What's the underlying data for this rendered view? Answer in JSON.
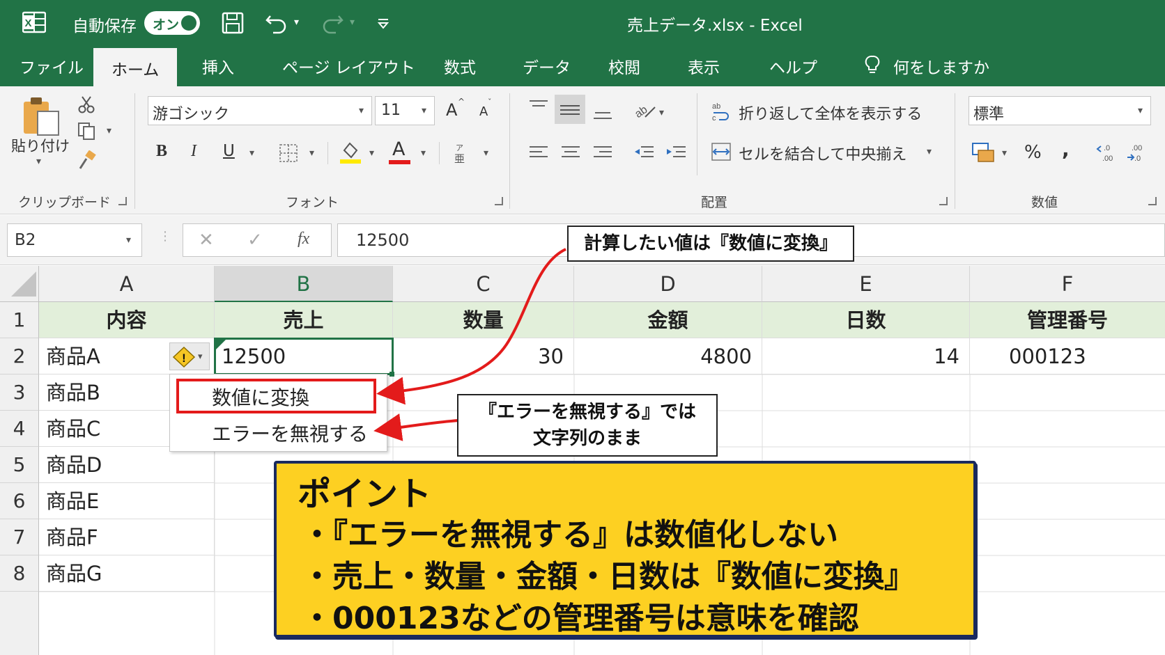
{
  "titlebar": {
    "autosave_label": "自動保存",
    "autosave_state": "オン",
    "title": "売上データ.xlsx  -  Excel"
  },
  "tabs": [
    "ファイル",
    "ホーム",
    "挿入",
    "ページ レイアウト",
    "数式",
    "データ",
    "校閲",
    "表示",
    "ヘルプ"
  ],
  "active_tab": "ホーム",
  "tell_me": "何をしますか",
  "ribbon": {
    "paste_label": "貼り付け",
    "clipboard_group": "クリップボード",
    "font_name": "游ゴシック",
    "font_size": "11",
    "font_group": "フォント",
    "bold": "B",
    "italic": "I",
    "underline": "U",
    "font_color_glyph": "A",
    "grow_font": "A",
    "shrink_font": "A",
    "wrap_text": "折り返して全体を表示する",
    "merge_center": "セルを結合して中央揃え",
    "alignment_group": "配置",
    "number_format": "標準",
    "percent": "%",
    "comma": ",",
    "number_group": "数値"
  },
  "formula_bar": {
    "name_box": "B2",
    "fx": "fx",
    "value": "12500"
  },
  "columns": [
    "A",
    "B",
    "C",
    "D",
    "E",
    "F"
  ],
  "selected_column": "B",
  "rows": [
    "1",
    "2",
    "3",
    "4",
    "5",
    "6",
    "7",
    "8"
  ],
  "headers": [
    "内容",
    "売上",
    "数量",
    "金額",
    "日数",
    "管理番号"
  ],
  "row2": [
    "商品A",
    "12500",
    "30",
    "4800",
    "14",
    "000123"
  ],
  "products": [
    "商品B",
    "商品C",
    "商品D",
    "商品E",
    "商品F",
    "商品G"
  ],
  "error_menu": {
    "convert": "数値に変換",
    "ignore": "エラーを無視する"
  },
  "callouts": {
    "top": "計算したい値は『数値に変換』",
    "middle_line1": "『エラーを無視する』では",
    "middle_line2": "文字列のまま"
  },
  "point": {
    "title": "ポイント",
    "items": [
      "・『エラーを無視する』は数値化しない",
      "・売上・数量・金額・日数は『数値に変換』",
      "・000123などの管理番号は意味を確認"
    ]
  },
  "colors": {
    "excel_green": "#217346",
    "header_fill": "#e2efda",
    "arrow_red": "#e31b1b",
    "point_yellow": "#fdd022",
    "point_border": "#1a2a5e"
  }
}
